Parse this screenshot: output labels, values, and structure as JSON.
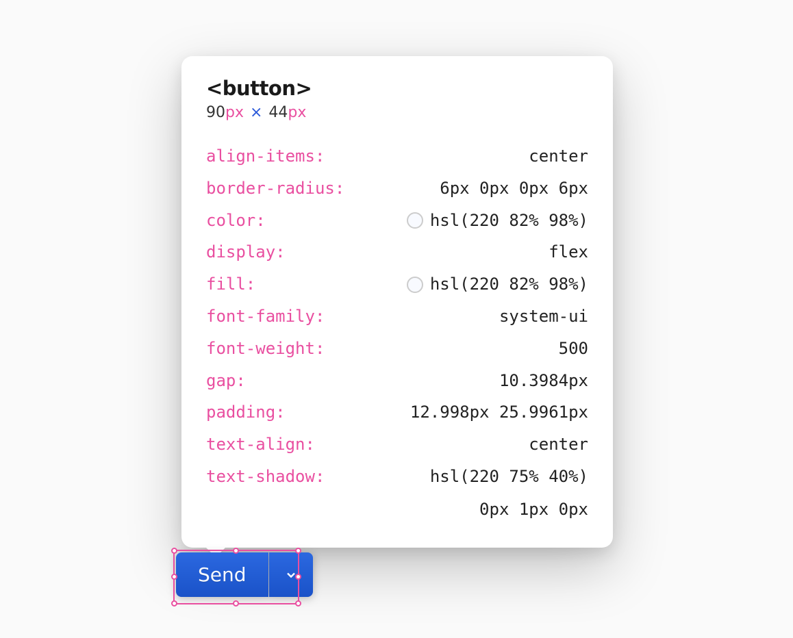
{
  "tooltip": {
    "element_tag": "<button>",
    "dimensions": {
      "width_num": "90",
      "width_unit": "px",
      "separator": "×",
      "height_num": "44",
      "height_unit": "px"
    },
    "properties": [
      {
        "name": "align-items:",
        "value": "center",
        "has_swatch": false
      },
      {
        "name": "border-radius:",
        "value": "6px 0px 0px 6px",
        "has_swatch": false
      },
      {
        "name": "color:",
        "value": "hsl(220 82% 98%)",
        "has_swatch": true
      },
      {
        "name": "display:",
        "value": "flex",
        "has_swatch": false
      },
      {
        "name": "fill:",
        "value": "hsl(220 82% 98%)",
        "has_swatch": true
      },
      {
        "name": "font-family:",
        "value": "system-ui",
        "has_swatch": false
      },
      {
        "name": "font-weight:",
        "value": "500",
        "has_swatch": false
      },
      {
        "name": "gap:",
        "value": "10.3984px",
        "has_swatch": false
      },
      {
        "name": "padding:",
        "value": "12.998px 25.9961px",
        "has_swatch": false
      },
      {
        "name": "text-align:",
        "value": "center",
        "has_swatch": false
      },
      {
        "name": "text-shadow:",
        "value_lines": [
          "hsl(220 75% 40%)",
          "0px 1px 0px"
        ],
        "has_swatch": false,
        "multiline": true
      }
    ]
  },
  "button": {
    "label": "Send"
  }
}
